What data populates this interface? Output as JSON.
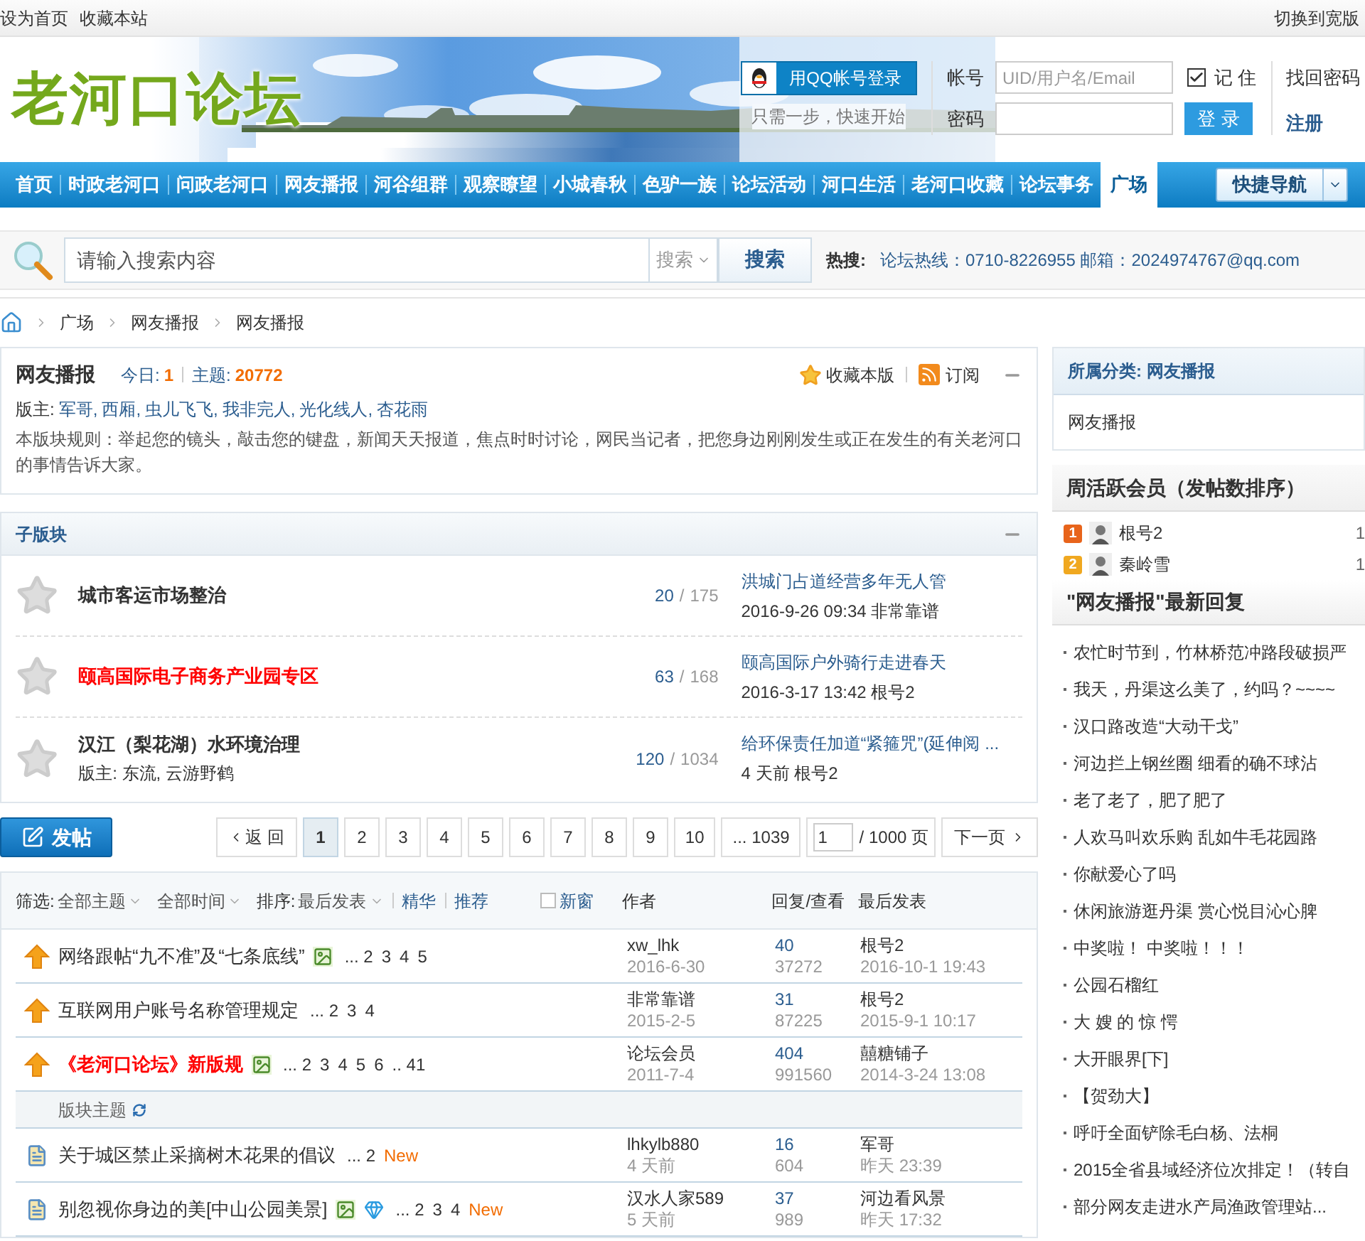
{
  "top_bar": {
    "links": [
      "设为首页",
      "收藏本站"
    ],
    "switch": "切换到宽版"
  },
  "header": {
    "logo": "老河口论坛",
    "qq_login": "用QQ帐号登录",
    "qq_hint": "只需一步，快速开始",
    "account_label": "帐号",
    "account_placeholder": "UID/用户名/Email",
    "remember": {
      "label": "记 住",
      "checked": true
    },
    "password_label": "密码",
    "login_button": "登 录",
    "recover": "找回密码",
    "register": "注册"
  },
  "nav": {
    "items": [
      {
        "label": "首页",
        "selected": false
      },
      {
        "label": "时政老河口",
        "selected": false
      },
      {
        "label": "问政老河口",
        "selected": false
      },
      {
        "label": "网友播报",
        "selected": false
      },
      {
        "label": "河谷组群",
        "selected": false
      },
      {
        "label": "观察瞭望",
        "selected": false
      },
      {
        "label": "小城春秋",
        "selected": false
      },
      {
        "label": "色驴一族",
        "selected": false
      },
      {
        "label": "论坛活动",
        "selected": false
      },
      {
        "label": "河口生活",
        "selected": false
      },
      {
        "label": "老河口收藏",
        "selected": false
      },
      {
        "label": "论坛事务",
        "selected": false
      },
      {
        "label": "广场",
        "selected": true
      }
    ],
    "quick_nav": "快捷导航"
  },
  "search": {
    "placeholder": "请输入搜索内容",
    "scope": "搜索",
    "button": "搜索",
    "hot_label": "热搜:",
    "hot_text": "论坛热线：0710-8226955 邮箱：2024974767@qq.com"
  },
  "breadcrumb": [
    "广场",
    "网友播报",
    "网友播报"
  ],
  "board": {
    "title": "网友播报",
    "today_label": "今日:",
    "today": "1",
    "topics_label": "主题:",
    "topics": "20772",
    "favorite": "收藏本版",
    "subscribe": "订阅",
    "moderators_label": "版主:",
    "moderators": [
      "军哥,",
      "西厢,",
      "虫儿飞飞,",
      "我非完人,",
      "光化线人,",
      "杏花雨"
    ],
    "rules": "本版块规则：举起您的镜头，敲击您的键盘，新闻天天报道，焦点时时讨论，网民当记者，把您身边刚刚发生或正在发生的有关老河口的事情告诉大家。"
  },
  "subboards": {
    "title": "子版块",
    "count_separator": "/",
    "items": [
      {
        "name": "城市客运市场整治",
        "highlighted": false,
        "today": "20",
        "total": "175",
        "last_title": "洪城门占道经营多年无人管",
        "last_meta": "2016-9-26 09:34 非常靠谱"
      },
      {
        "name": "颐高国际电子商务产业园专区",
        "highlighted": true,
        "today": "63",
        "total": "168",
        "last_title": "颐高国际户外骑行走进春天",
        "last_meta": "2016-3-17 13:42 根号2"
      },
      {
        "name": "汉江（梨花湖）水环境治理",
        "highlighted": false,
        "moderators": "版主: 东流, 云游野鹤",
        "today": "120",
        "total": "1034",
        "last_title": "给环保责任加道“紧箍咒”(延伸阅 ...",
        "last_meta": "4 天前  根号2"
      }
    ]
  },
  "post_button": "发帖",
  "pagination": {
    "prev": "返 回",
    "pages": [
      {
        "label": "1",
        "selected": true
      },
      {
        "label": "2",
        "selected": false
      },
      {
        "label": "3",
        "selected": false
      },
      {
        "label": "4",
        "selected": false
      },
      {
        "label": "5",
        "selected": false
      },
      {
        "label": "6",
        "selected": false
      },
      {
        "label": "7",
        "selected": false
      },
      {
        "label": "8",
        "selected": false
      },
      {
        "label": "9",
        "selected": false
      },
      {
        "label": "10",
        "selected": false
      },
      {
        "label": "... 1039",
        "selected": false
      }
    ],
    "page_input": "1",
    "total": "/ 1000 页",
    "next": "下一页"
  },
  "thread_list": {
    "filter_label": "筛选:",
    "filter_type": "全部主题",
    "filter_time": "全部时间",
    "sort_label": "排序:",
    "sort_value": "最后发表",
    "digest": "精华",
    "recommend": "推荐",
    "new_window": {
      "label": "新窗",
      "checked": false
    },
    "columns": [
      "作者",
      "回复/查看",
      "最后发表"
    ],
    "rows": [
      {
        "kind": "sticky",
        "title": "网络跟帖“九不准”及“七条底线”",
        "highlighted": false,
        "image": true,
        "diamond": false,
        "pages": [
          "... 2",
          "3",
          "4",
          "5"
        ],
        "new": "",
        "author": "xw_lhk",
        "date": "2016-6-30",
        "replies": "40",
        "views": "37272",
        "last_user": "根号2",
        "last_time": "2016-10-1 19:43"
      },
      {
        "kind": "sticky",
        "title": "互联网用户账号名称管理规定",
        "highlighted": false,
        "image": false,
        "diamond": false,
        "pages": [
          "... 2",
          "3",
          "4"
        ],
        "new": "",
        "author": "非常靠谱",
        "date": "2015-2-5",
        "replies": "31",
        "views": "87225",
        "last_user": "根号2",
        "last_time": "2015-9-1 10:17"
      },
      {
        "kind": "sticky",
        "title": "《老河口论坛》新版规",
        "highlighted": true,
        "image": true,
        "diamond": false,
        "pages": [
          "... 2",
          "3",
          "4",
          "5",
          "6",
          ".. 41"
        ],
        "new": "",
        "author": "论坛会员",
        "date": "2011-7-4",
        "replies": "404",
        "views": "991560",
        "last_user": "囍糖铺子",
        "last_time": "2014-3-24 13:08"
      },
      {
        "kind": "separator",
        "title": "版块主题"
      },
      {
        "kind": "normal",
        "title": "关于城区禁止采摘树木花果的倡议",
        "highlighted": false,
        "image": false,
        "diamond": false,
        "pages": [
          "... 2"
        ],
        "new": "New",
        "author": "lhkylb880",
        "date": "4 天前",
        "replies": "16",
        "views": "604",
        "last_user": "军哥",
        "last_time": "昨天 23:39"
      },
      {
        "kind": "normal",
        "title": "别忽视你身边的美[中山公园美景]",
        "highlighted": false,
        "image": true,
        "diamond": true,
        "pages": [
          "... 2",
          "3",
          "4"
        ],
        "new": "New",
        "author": "汉水人家589",
        "date": "5 天前",
        "replies": "37",
        "views": "989",
        "last_user": "河边看风景",
        "last_time": "昨天 17:32"
      }
    ]
  },
  "sidebar": {
    "category_title": "所属分类: 网友播报",
    "category_item": "网友播报",
    "members_title": "周活跃会员（发帖数排序）",
    "members": [
      {
        "rank": "1",
        "color": "#e8641b",
        "name": "根号2",
        "count": "1"
      },
      {
        "rank": "2",
        "color": "#f0a820",
        "name": "秦岭雪",
        "count": "1"
      }
    ],
    "replies_title": "\"网友播报\"最新回复",
    "replies": [
      "农忙时节到，竹林桥范冲路段破损严",
      "我天，丹渠这么美了，约吗？~~~~",
      "汉口路改造“大动干戈”",
      "河边拦上钢丝圈 细看的确不球沾",
      "老了老了，肥了肥了",
      "人欢马叫欢乐购 乱如牛毛花园路",
      "你献爱心了吗",
      "休闲旅游逛丹渠 赏心悦目沁心脾",
      "中奖啦！  中奖啦！！！",
      "公园石榴红",
      "大 嫂 的 惊 愕",
      "大开眼界[下]",
      "【贺劲大】",
      "呼吁全面铲除毛白杨、法桐",
      "2015全省县域经济位次排定！（转自",
      "部分网友走进水产局渔政管理站..."
    ]
  }
}
